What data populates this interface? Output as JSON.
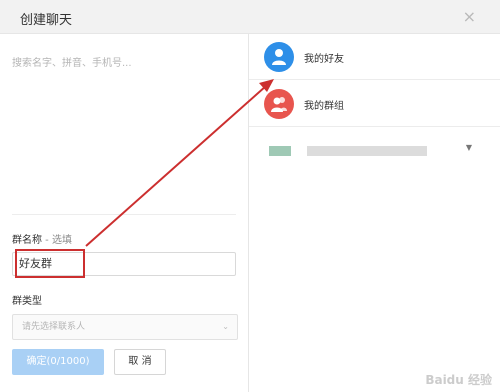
{
  "dialog": {
    "title": "创建聊天",
    "close_glyph": "×"
  },
  "left": {
    "search_placeholder": "搜索名字、拼音、手机号...",
    "group_name_label": "群名称",
    "group_name_optional": " - 选填",
    "group_name_value": "好友群",
    "group_type_label": "群类型",
    "group_type_placeholder": "请先选择联系人",
    "confirm_label": "确定(0/1000)",
    "cancel_label": "取 消"
  },
  "right": {
    "items": [
      {
        "label": "我的好友",
        "icon": "user-icon",
        "color": "#2e8fe8"
      },
      {
        "label": "我的群组",
        "icon": "group-icon",
        "color": "#e8554e"
      }
    ]
  },
  "watermark": {
    "text": "Baidu 经验"
  },
  "colors": {
    "accent_blue": "#2e8fe8",
    "accent_red": "#e8554e",
    "annotation_red": "#cc2f2f",
    "confirm_disabled": "#a9d0f5"
  }
}
